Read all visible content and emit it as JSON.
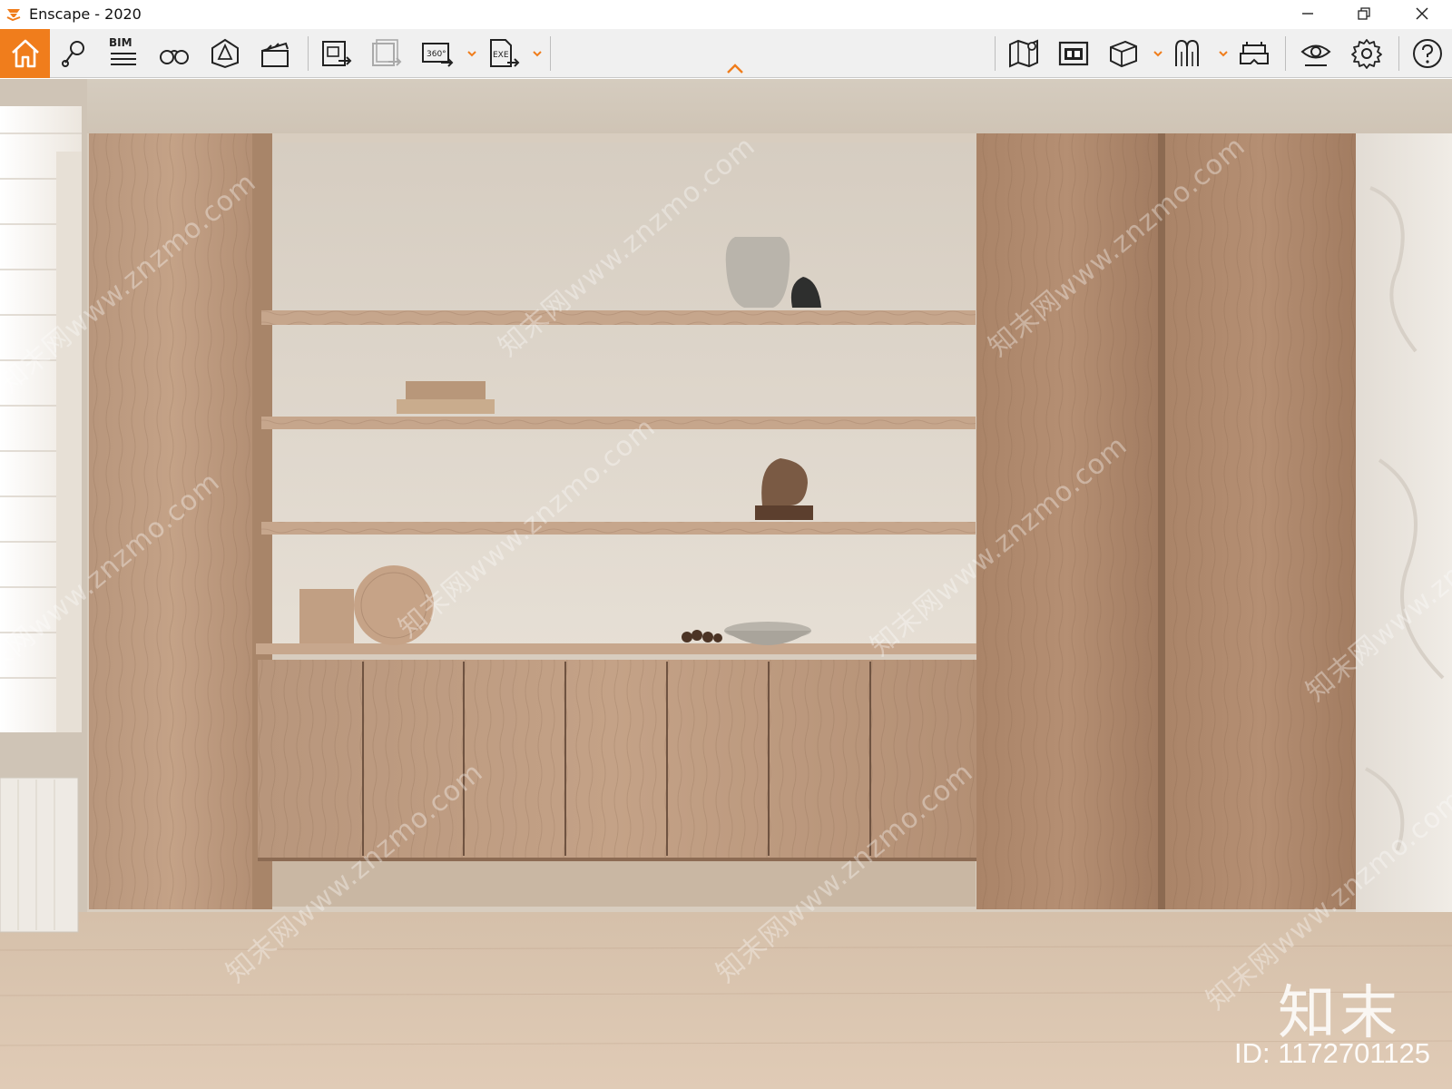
{
  "window": {
    "title": "Enscape - 2020",
    "minimize_glyph": "—",
    "maximize_glyph": "❐",
    "close_glyph": "✕"
  },
  "toolbar": {
    "bim_label": "BIM",
    "accent_color": "#f07d1c",
    "buttons_left": [
      {
        "name": "home-icon"
      },
      {
        "name": "location-pin-icon"
      },
      {
        "name": "bim-info-icon"
      },
      {
        "name": "binoculars-icon"
      },
      {
        "name": "light-view-icon"
      },
      {
        "name": "video-editor-icon"
      },
      {
        "name": "export-image-icon"
      },
      {
        "name": "batch-export-icon"
      },
      {
        "name": "panorama-360-icon",
        "has_dropdown": true
      },
      {
        "name": "export-exe-icon",
        "has_dropdown": true,
        "label": "EXE"
      }
    ],
    "buttons_right": [
      {
        "name": "map-icon"
      },
      {
        "name": "views-manager-icon"
      },
      {
        "name": "asset-library-icon",
        "has_dropdown": true
      },
      {
        "name": "material-editor-icon",
        "has_dropdown": true
      },
      {
        "name": "vr-headset-icon"
      },
      {
        "name": "visual-settings-icon"
      },
      {
        "name": "settings-icon"
      },
      {
        "name": "help-icon"
      }
    ]
  },
  "viewport": {
    "watermark_text": "知末网www.znzmo.com",
    "logo_text": "知末",
    "id_text": "ID: 1172701125"
  }
}
